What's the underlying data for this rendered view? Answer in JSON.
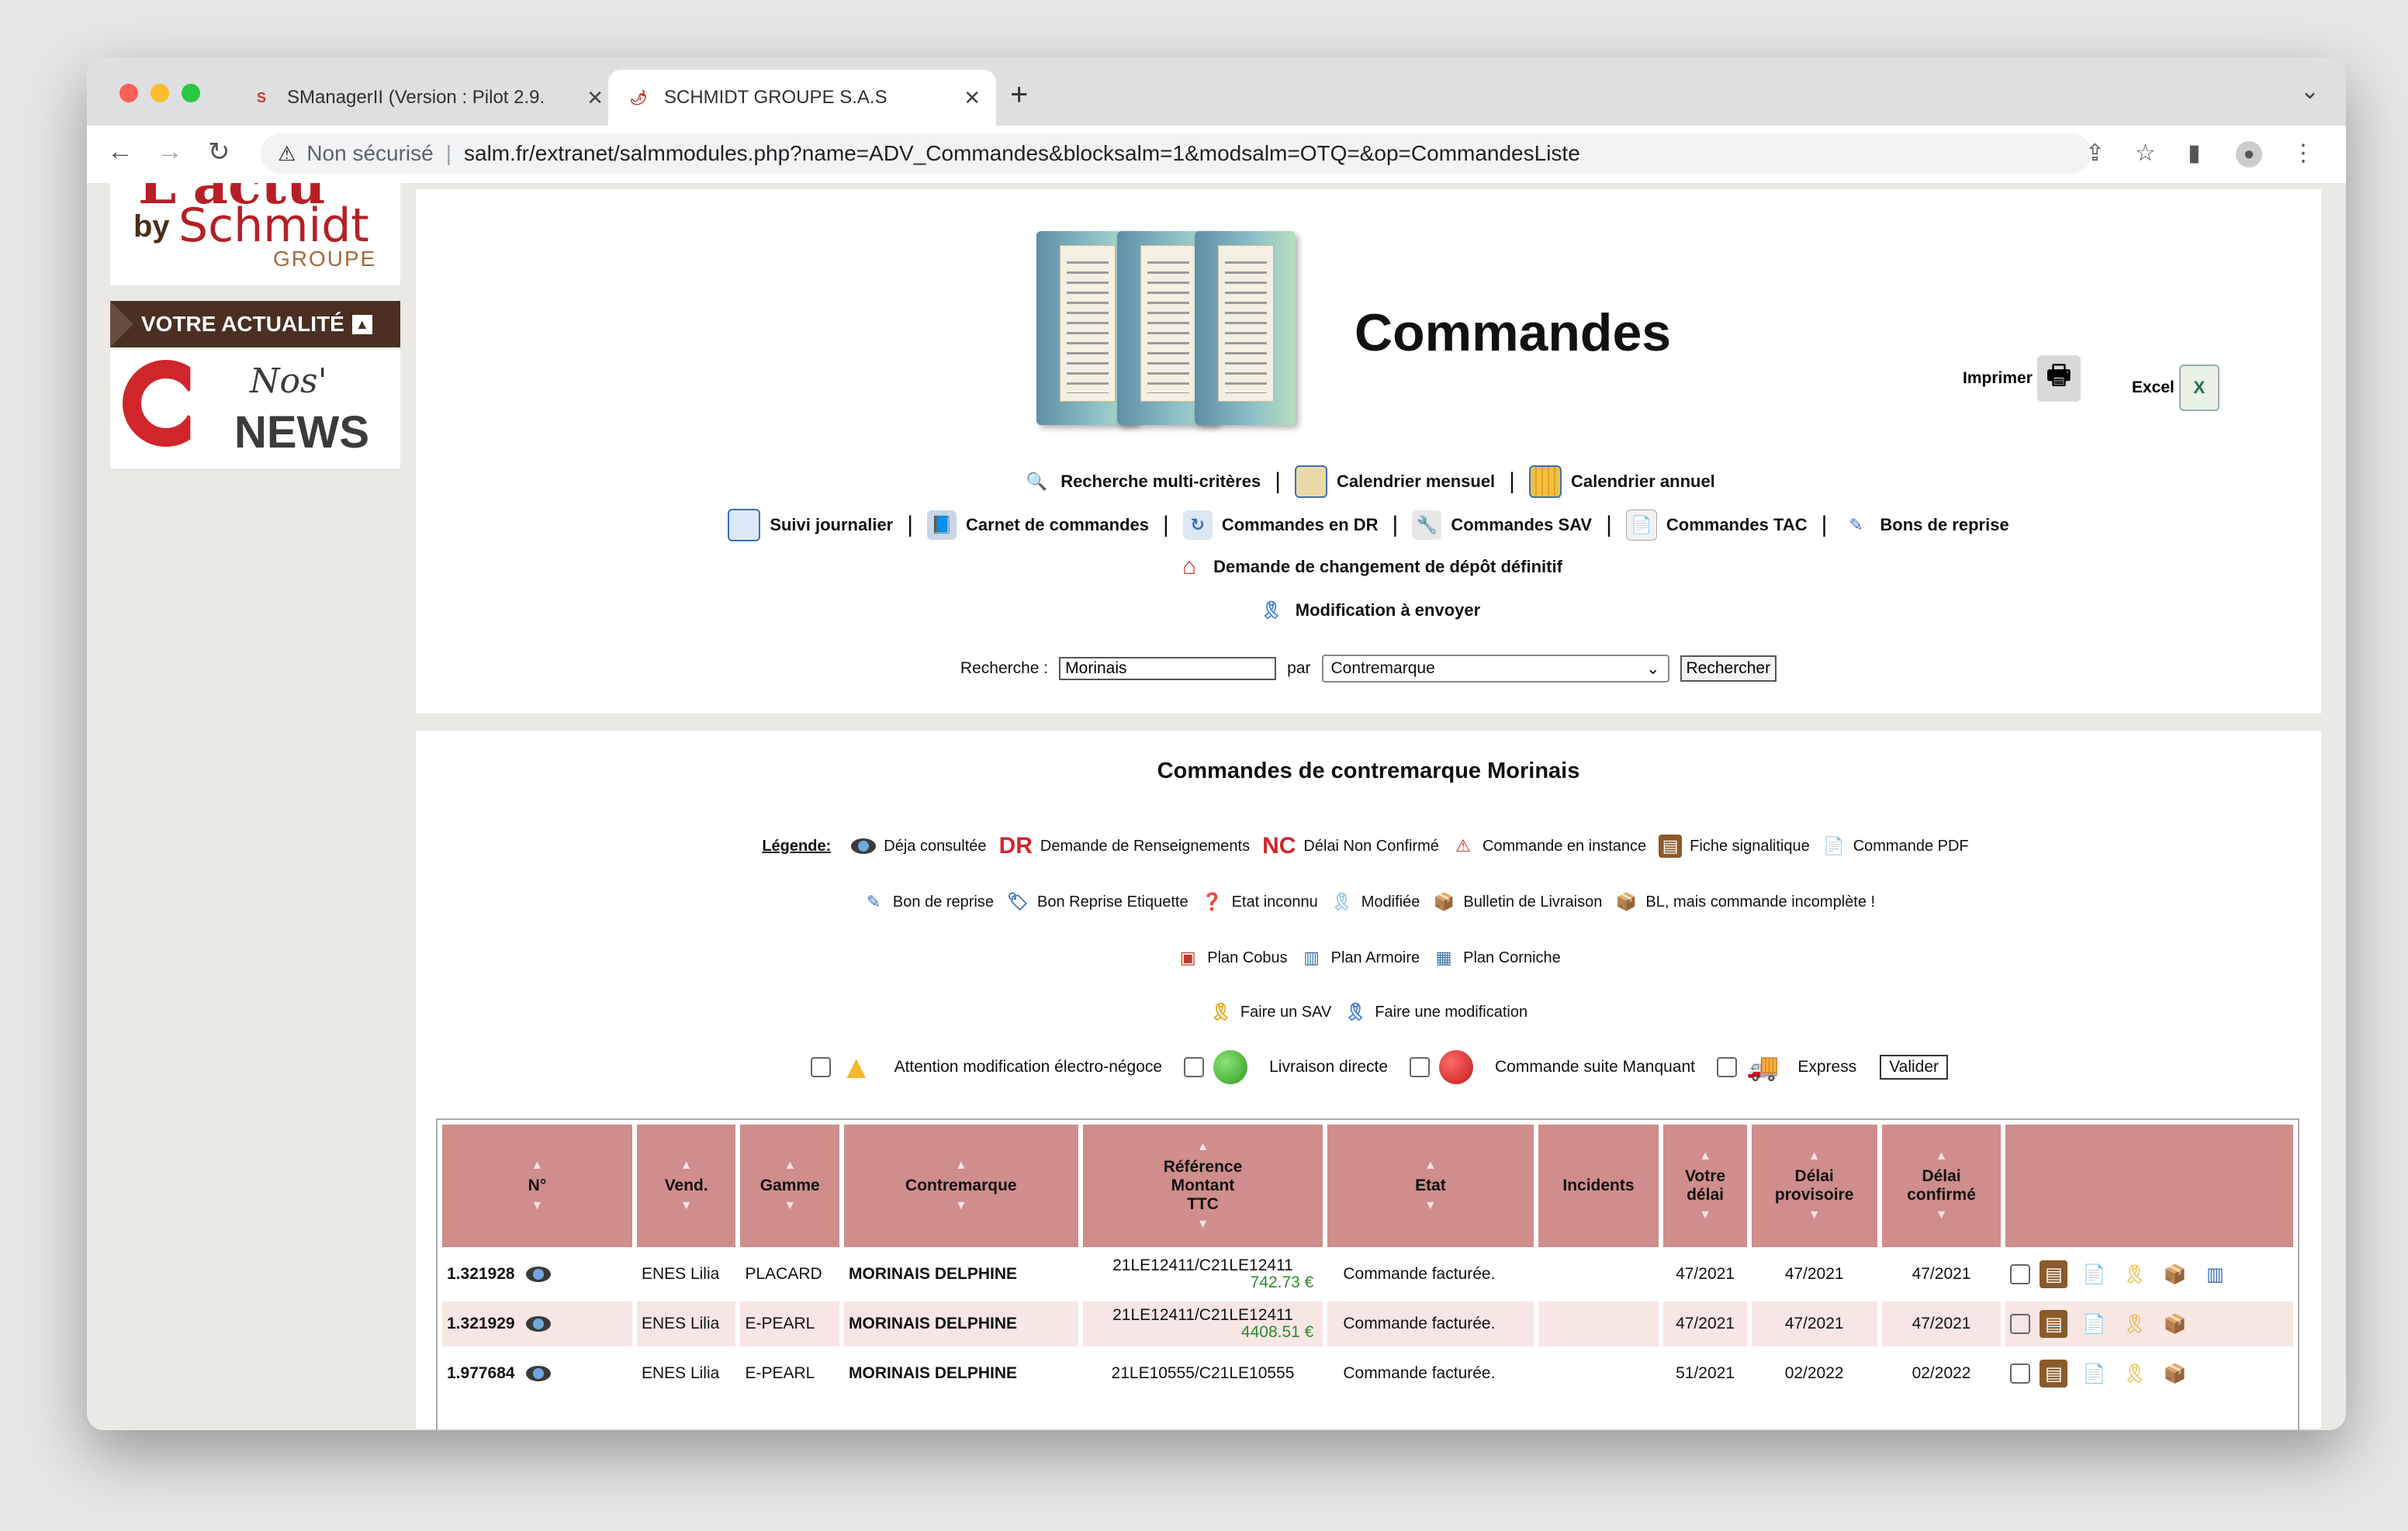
{
  "browser": {
    "tabs": [
      {
        "title": "SManagerII (Version : Pilot 2.9.",
        "favicon": "S"
      },
      {
        "title": "SCHMIDT GROUPE S.A.S",
        "favicon": "🌶"
      }
    ],
    "security_label": "Non sécurisé",
    "url": "salm.fr/extranet/salmmodules.php?name=ADV_Commandes&blocksalm=1&modsalm=OTQ=&op=CommandesListe"
  },
  "sidebar": {
    "logo_top": "L'actu",
    "logo_by": "by",
    "logo_brand": "Schmidt",
    "logo_group": "GROUPE",
    "banner": "VOTRE ACTUALITÉ",
    "news_nos": "Nos'",
    "news_news": "NEWS"
  },
  "header": {
    "title": "Commandes",
    "print_label": "Imprimer",
    "excel_label": "Excel"
  },
  "nav": {
    "row1": [
      "Recherche multi-critères",
      "Calendrier mensuel",
      "Calendrier annuel"
    ],
    "row2": [
      "Suivi journalier",
      "Carnet de commandes",
      "Commandes en DR",
      "Commandes SAV",
      "Commandes TAC",
      "Bons de reprise"
    ],
    "row3": "Demande de changement de dépôt définitif",
    "row4": "Modification à envoyer"
  },
  "search": {
    "label": "Recherche :",
    "value": "Morinais",
    "par": "par",
    "select_value": "Contremarque",
    "button": "Rechercher"
  },
  "results": {
    "title": "Commandes de contremarque Morinais",
    "legend_title": "Légende:",
    "legend_row1": [
      "Déja consultée",
      "Demande de Renseignements",
      "Délai Non Confirmé",
      "Commande en instance",
      "Fiche signalitique",
      "Commande PDF"
    ],
    "legend_dr": "DR",
    "legend_nc": "NC",
    "legend_row2": [
      "Bon de reprise",
      "Bon Reprise Etiquette",
      "Etat inconnu",
      "Modifiée",
      "Bulletin de Livraison",
      "BL, mais commande incomplète !"
    ],
    "legend_row3": [
      "Plan Cobus",
      "Plan Armoire",
      "Plan Corniche"
    ],
    "legend_row4": [
      "Faire un SAV",
      "Faire une modification"
    ],
    "options": [
      "Attention modification électro-négoce",
      "Livraison directe",
      "Commande suite Manquant",
      "Express"
    ],
    "valider": "Valider",
    "columns": [
      "N°",
      "Vend.",
      "Gamme",
      "Contremarque",
      "Référence Montant TTC",
      "Etat",
      "Incidents",
      "Votre délai",
      "Délai provisoire",
      "Délai confirmé",
      ""
    ],
    "rows": [
      {
        "num": "1.321928",
        "vend": "ENES Lilia",
        "gamme": "PLACARD",
        "contremarque": "MORINAIS DELPHINE",
        "ref": "21LE12411/C21LE12411",
        "amount": "742.73 €",
        "etat": "Commande facturée.",
        "incidents": "",
        "votre": "47/2021",
        "prov": "47/2021",
        "conf": "47/2021"
      },
      {
        "num": "1.321929",
        "vend": "ENES Lilia",
        "gamme": "E-PEARL",
        "contremarque": "MORINAIS DELPHINE",
        "ref": "21LE12411/C21LE12411",
        "amount": "4408.51 €",
        "etat": "Commande facturée.",
        "incidents": "",
        "votre": "47/2021",
        "prov": "47/2021",
        "conf": "47/2021"
      },
      {
        "num": "1.977684",
        "vend": "ENES Lilia",
        "gamme": "E-PEARL",
        "contremarque": "MORINAIS DELPHINE",
        "ref": "21LE10555/C21LE10555",
        "amount": "",
        "etat": "Commande facturée.",
        "incidents": "",
        "votre": "51/2021",
        "prov": "02/2022",
        "conf": "02/2022"
      }
    ]
  },
  "colors": {
    "header_bg": "#cf8d8b",
    "alt_row": "#f8e6e5",
    "amount": "#2e8b2e",
    "brand_red": "#b61f25"
  }
}
